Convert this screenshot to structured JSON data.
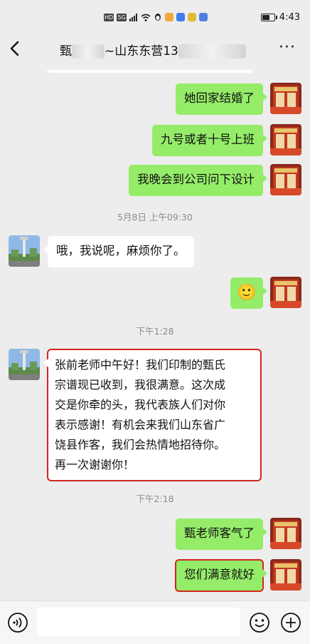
{
  "status_bar": {
    "network_badges": [
      "HD",
      "5G",
      "ill",
      "WiFi"
    ],
    "app_badges": [
      "qq",
      "wx",
      "b",
      "m",
      "w"
    ],
    "time": "4:43",
    "battery_level": 0.65
  },
  "header": {
    "title_start": "甄",
    "title_middle": "~山东东营13",
    "more_label": "···"
  },
  "messages": [
    {
      "from": "me",
      "text": "她回家结婚了"
    },
    {
      "from": "me",
      "text": "九号或者十号上班"
    },
    {
      "from": "me",
      "text": "我晚会到公司问下设计"
    },
    {
      "timestamp": "5月8日 上午09:30"
    },
    {
      "from": "them",
      "text": "哦，我说呢，麻烦你了。"
    },
    {
      "from": "me",
      "emoji": "🙂"
    },
    {
      "timestamp": "下午1:28"
    },
    {
      "from": "them",
      "lines": [
        "张前老师中午好！我们印制的甄氏",
        "宗谱现已收到，我很满意。这次成",
        "交是你牵的头，我代表族人们对你",
        "表示感谢！有机会来我们山东省广",
        "饶县作客，我们会热情地招待你。",
        "再一次谢谢你！"
      ]
    },
    {
      "timestamp": "下午2:18"
    },
    {
      "from": "me",
      "text": "甄老师客气了"
    },
    {
      "from": "me",
      "text": "您们满意就好"
    }
  ],
  "input_bar": {
    "voice_icon": "voice-icon",
    "emoji_icon": "emoji-icon",
    "plus_icon": "plus-icon",
    "draft": ""
  }
}
